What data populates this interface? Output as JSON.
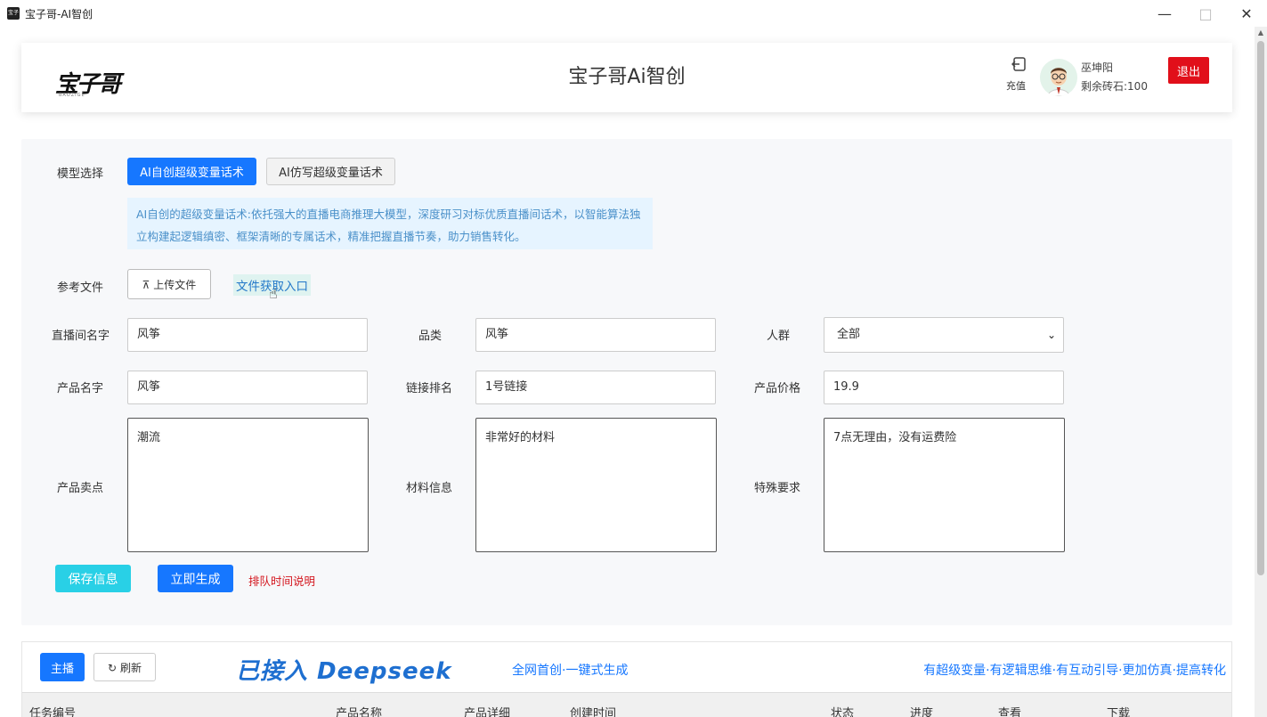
{
  "window": {
    "title": "宝子哥-AI智创",
    "icon_label": "宝子"
  },
  "header": {
    "logo": "宝子哥",
    "logo_sub": "BAOZIGE",
    "title": "宝子哥Ai智创",
    "recharge": "充值",
    "user_name": "巫坤阳",
    "diamonds": "剩余砖石:100",
    "logout": "退出"
  },
  "form": {
    "model_label": "模型选择",
    "model_option_1": "AI自创超级变量话术",
    "model_option_2": "AI仿写超级变量话术",
    "description": "AI自创的超级变量话术:依托强大的直播电商推理大模型，深度研习对标优质直播间话术，以智能算法独立构建起逻辑缜密、框架清晰的专属话术，精准把握直播节奏，助力销售转化。",
    "ref_label": "参考文件",
    "upload": "上传文件",
    "file_link": "文件获取入口",
    "live_name_label": "直播间名字",
    "live_name": "风筝",
    "category_label": "品类",
    "category": "风筝",
    "crowd_label": "人群",
    "crowd": "全部",
    "product_name_label": "产品名字",
    "product_name": "风筝",
    "link_rank_label": "链接排名",
    "link_rank": "1号链接",
    "price_label": "产品价格",
    "price": "19.9",
    "selling_label": "产品卖点",
    "selling": "潮流",
    "material_label": "材料信息",
    "material": "非常好的材料",
    "special_label": "特殊要求",
    "special": "7点无理由，没有运费险",
    "save": "保存信息",
    "generate": "立即生成",
    "queue": "排队时间说明"
  },
  "bottom": {
    "main": "主播",
    "refresh": "刷新",
    "deepseek_banner": "已接入 Deepseek",
    "slogan_1": "全网首创·一键式生成",
    "slogan_2": "有超级变量·有逻辑思维·有互动引导·更加仿真·提高转化",
    "columns": [
      "任务编号",
      "产品名称",
      "产品详细",
      "创建时间",
      "状态",
      "进度",
      "查看",
      "下载"
    ]
  }
}
